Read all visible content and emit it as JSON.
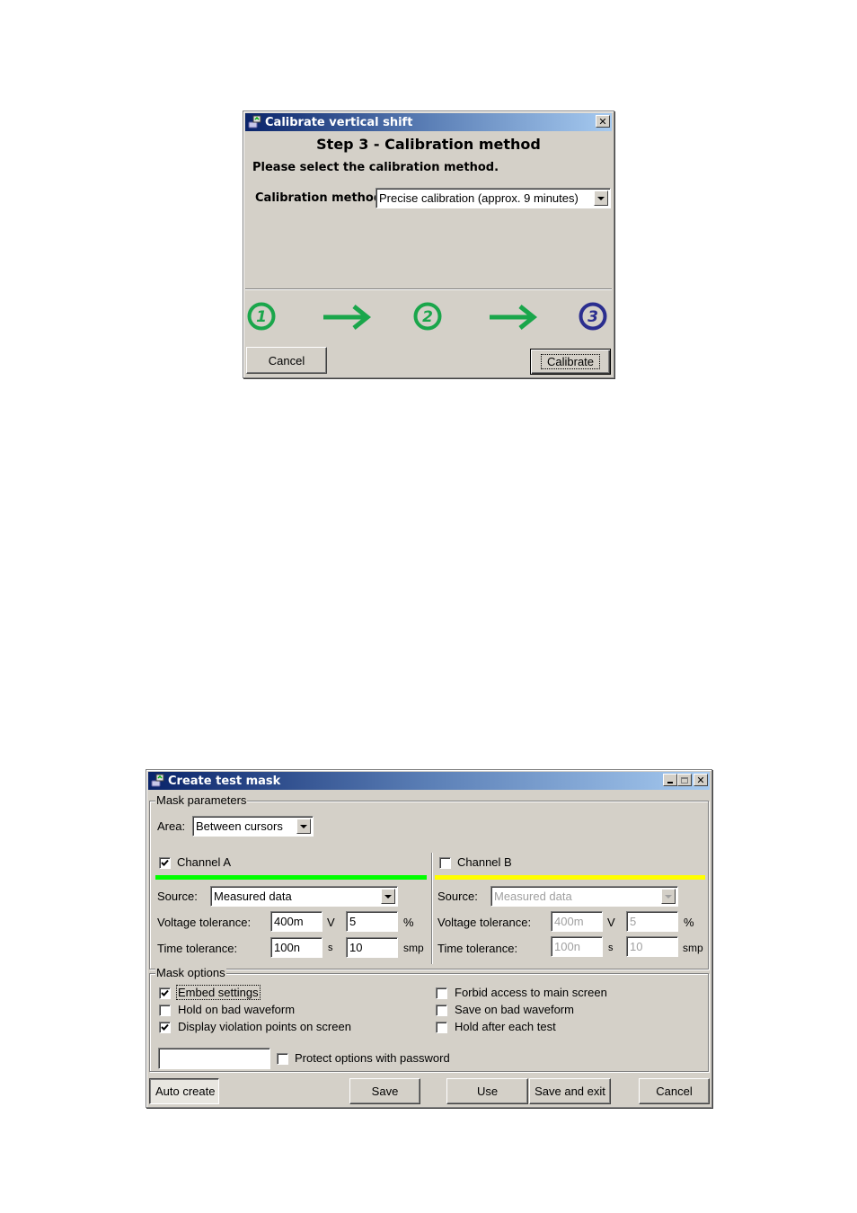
{
  "calibrate_dialog": {
    "title": "Calibrate vertical shift",
    "step_heading": "Step 3 - Calibration method",
    "instruction": "Please select the calibration method.",
    "method_label": "Calibration method:",
    "method_value": "Precise calibration (approx. 9 minutes)",
    "steps": [
      {
        "number": "1",
        "state": "done",
        "color": "#1aa64b"
      },
      {
        "number": "2",
        "state": "done",
        "color": "#1aa64b"
      },
      {
        "number": "3",
        "state": "current",
        "color": "#2b2e8f"
      }
    ],
    "cancel_label": "Cancel",
    "calibrate_label": "Calibrate"
  },
  "mask_dialog": {
    "title": "Create test mask",
    "mask_parameters_title": "Mask parameters",
    "area_label": "Area:",
    "area_value": "Between cursors",
    "channels": [
      {
        "name": "Channel A",
        "checked": true,
        "color": "#00ff00",
        "source_label": "Source:",
        "source_value": "Measured data",
        "voltage_label": "Voltage tolerance:",
        "voltage_value": "400m",
        "voltage_unit": "V",
        "voltage_pct": "5",
        "voltage_pct_unit": "%",
        "time_label": "Time tolerance:",
        "time_value": "100n",
        "time_unit": "s",
        "time_samples": "10",
        "time_samples_unit": "smp",
        "enabled": true
      },
      {
        "name": "Channel B",
        "checked": false,
        "color": "#ffff00",
        "source_label": "Source:",
        "source_value": "Measured data",
        "voltage_label": "Voltage tolerance:",
        "voltage_value": "400m",
        "voltage_unit": "V",
        "voltage_pct": "5",
        "voltage_pct_unit": "%",
        "time_label": "Time tolerance:",
        "time_value": "100n",
        "time_unit": "s",
        "time_samples": "10",
        "time_samples_unit": "smp",
        "enabled": false
      }
    ],
    "mask_options_title": "Mask options",
    "options_left": [
      {
        "label": "Embed settings",
        "checked": true
      },
      {
        "label": "Hold on bad waveform",
        "checked": false
      },
      {
        "label": "Display violation points on screen",
        "checked": true
      }
    ],
    "options_right": [
      {
        "label": "Forbid access to main screen",
        "checked": false
      },
      {
        "label": "Save on bad waveform",
        "checked": false
      },
      {
        "label": "Hold after each test",
        "checked": false
      }
    ],
    "password_value": "",
    "protect_label": "Protect options with password",
    "protect_checked": false,
    "buttons": {
      "auto_create": "Auto create",
      "save": "Save",
      "use": "Use",
      "save_and_exit": "Save and exit",
      "cancel": "Cancel"
    }
  }
}
